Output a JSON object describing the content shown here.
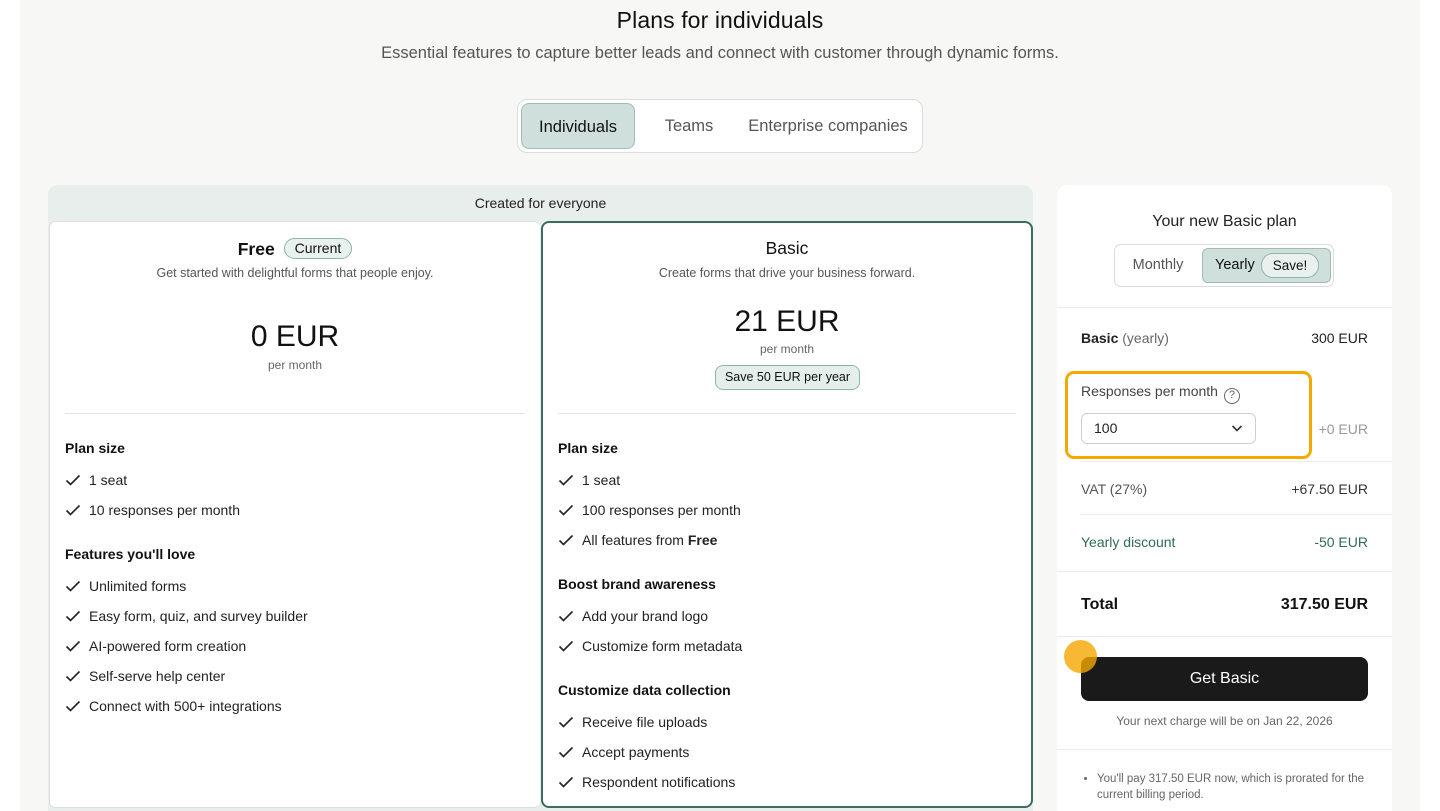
{
  "header": {
    "title": "Plans for individuals",
    "subtitle": "Essential features to capture better leads and connect with customer through dynamic forms."
  },
  "audience_tabs": [
    {
      "label": "Individuals",
      "active": true
    },
    {
      "label": "Teams",
      "active": false
    },
    {
      "label": "Enterprise companies",
      "active": false
    }
  ],
  "plans_group_label": "Created for everyone",
  "free_plan": {
    "name": "Free",
    "badge": "Current",
    "description": "Get started with delightful forms that people enjoy.",
    "price": "0 EUR",
    "per": "per month",
    "sections": [
      {
        "title": "Plan size",
        "items": [
          "1 seat",
          "10 responses per month"
        ]
      },
      {
        "title": "Features you'll love",
        "items": [
          "Unlimited forms",
          "Easy form, quiz, and survey builder",
          "AI-powered form creation",
          "Self-serve help center",
          "Connect with 500+ integrations"
        ]
      }
    ]
  },
  "basic_plan": {
    "name": "Basic",
    "description": "Create forms that drive your business forward.",
    "price": "21 EUR",
    "per": "per month",
    "save_pill": "Save 50 EUR per year",
    "sections": [
      {
        "title": "Plan size",
        "items": [
          "1 seat",
          "100 responses per month"
        ],
        "extra_prefix": "All features from ",
        "extra_bold": "Free"
      },
      {
        "title": "Boost brand awareness",
        "items": [
          "Add your brand logo",
          "Customize form metadata"
        ]
      },
      {
        "title": "Customize data collection",
        "items": [
          "Receive file uploads",
          "Accept payments",
          "Respondent notifications"
        ]
      }
    ]
  },
  "summary": {
    "title": "Your new Basic plan",
    "period_monthly": "Monthly",
    "period_yearly": "Yearly",
    "period_save": "Save!",
    "plan_label": "Basic",
    "plan_label_muted": "(yearly)",
    "plan_value": "300 EUR",
    "responses_label": "Responses per month",
    "help_icon": "?",
    "responses_selected": "100",
    "responses_extra": "+0 EUR",
    "vat_label": "VAT (27%)",
    "vat_value": "+67.50 EUR",
    "discount_label": "Yearly discount",
    "discount_value": "-50 EUR",
    "total_label": "Total",
    "total_value": "317.50 EUR",
    "cta_label": "Get Basic",
    "next_charge": "Your next charge will be on Jan 22, 2026",
    "note": "You'll pay 317.50 EUR now, which is prorated for the current billing period."
  },
  "colors": {
    "accent_bg": "#cfe0dc",
    "accent_border": "#3d6b5f",
    "highlight": "#f5a800",
    "cta_bg": "#1a1a1a"
  }
}
